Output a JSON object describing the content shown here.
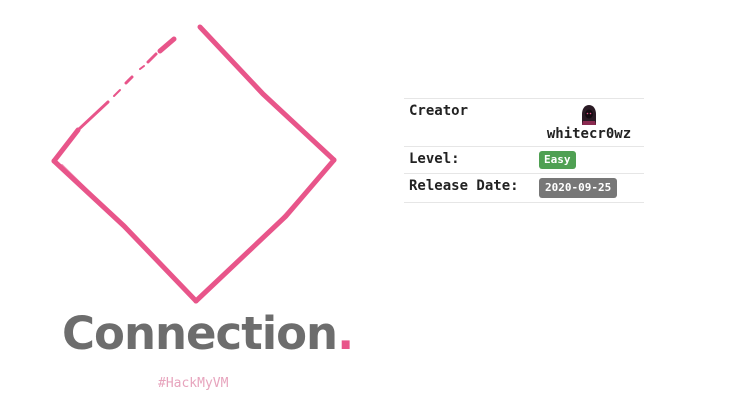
{
  "machine": {
    "name": "Connection",
    "name_suffix": ".",
    "hashtag": "#HackMyVM"
  },
  "info_table": {
    "creator_label": "Creator",
    "creator_name": "whitecr0wz",
    "creator_avatar_icon": "hooded-figure-avatar-icon",
    "level_label": "Level:",
    "level_value": "Easy",
    "release_label": "Release Date:",
    "release_value": "2020-09-25"
  },
  "colors": {
    "accent_pink": "#e8558a",
    "title_gray": "#6d6d6d",
    "level_green": "#4fa053",
    "date_gray": "#777777"
  }
}
